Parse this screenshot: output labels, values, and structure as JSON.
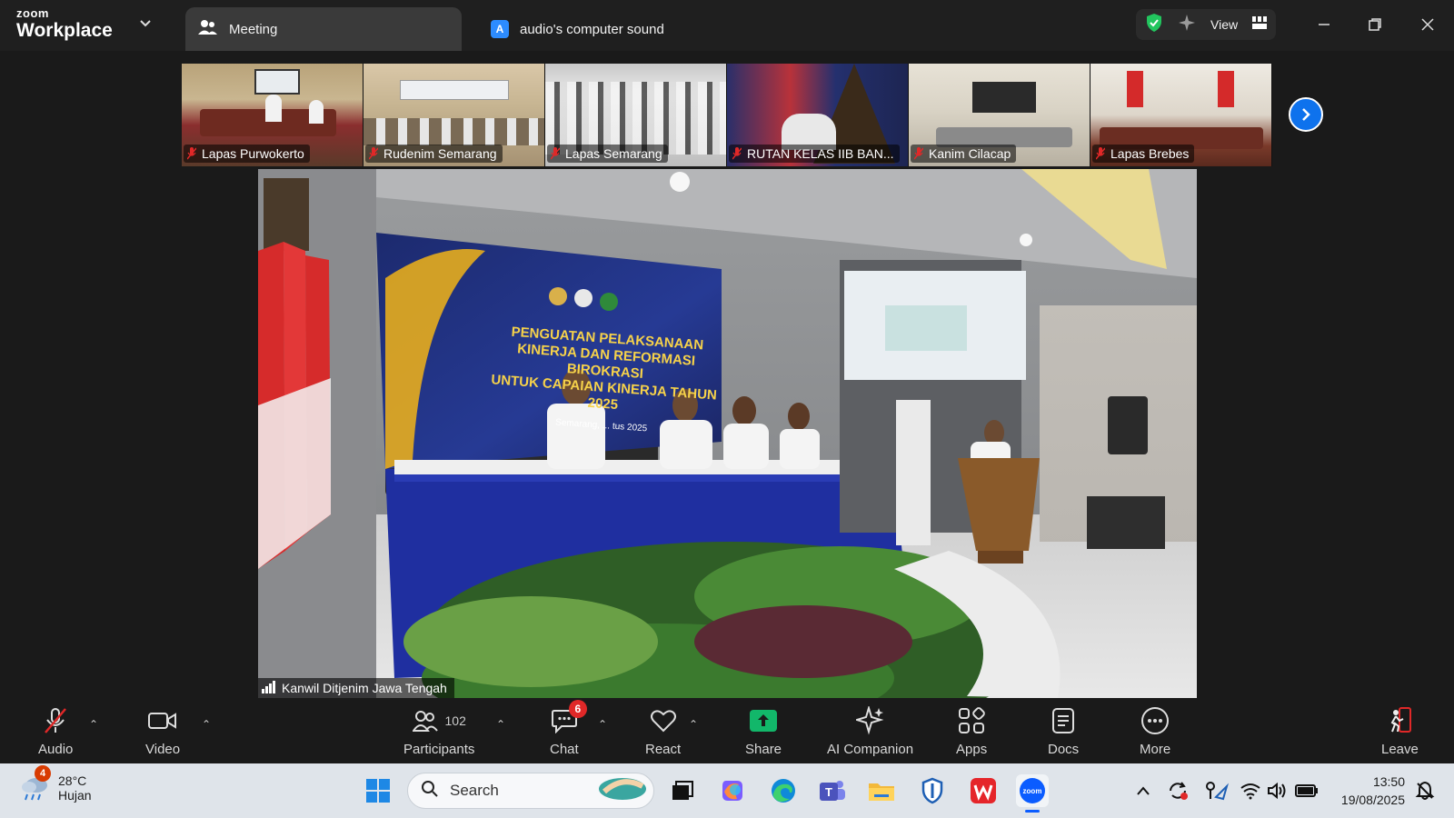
{
  "titlebar": {
    "brand_top": "zoom",
    "brand_bottom": "Workplace",
    "tab_meeting": "Meeting",
    "tab_audio": "audio's computer sound",
    "tab_audio_badge": "A",
    "view_label": "View"
  },
  "thumbnails": [
    {
      "name": "Lapas Purwokerto"
    },
    {
      "name": "Rudenim Semarang"
    },
    {
      "name": "Lapas Semarang"
    },
    {
      "name": "RUTAN KELAS IIB BAN..."
    },
    {
      "name": "Kanim Cilacap"
    },
    {
      "name": "Lapas Brebes"
    }
  ],
  "main_video": {
    "speaker_name": "Kanwil Ditjenim Jawa Tengah",
    "banner_line1": "PENGUATAN PELAKSANAAN",
    "banner_line2": "KINERJA DAN REFORMASI BIROKRASI",
    "banner_line3": "UNTUK CAPAIAN KINERJA TAHUN 2025",
    "banner_line4": "Semarang, ... tus 2025"
  },
  "toolbar": {
    "audio": "Audio",
    "video": "Video",
    "participants": "Participants",
    "participants_count": "102",
    "chat": "Chat",
    "chat_badge": "6",
    "react": "React",
    "share": "Share",
    "ai_companion": "AI Companion",
    "apps": "Apps",
    "docs": "Docs",
    "more": "More",
    "leave": "Leave"
  },
  "taskbar": {
    "weather_badge": "4",
    "temperature": "28°C",
    "condition": "Hujan",
    "search_placeholder": "Search",
    "time": "13:50",
    "date": "19/08/2025"
  },
  "colors": {
    "zoom_blue": "#0e72ed",
    "share_green": "#12b76a",
    "alert_red": "#e02828"
  }
}
